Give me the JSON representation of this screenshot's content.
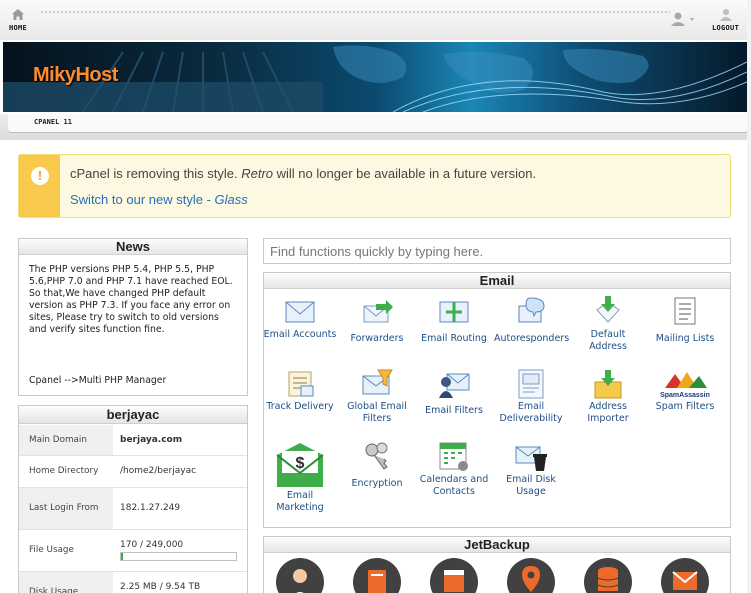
{
  "nav": {
    "home": "HOME",
    "logout": "LOGOUT"
  },
  "banner": {
    "logo": "MikyHost"
  },
  "tab": {
    "label": "CPANEL 11"
  },
  "notice": {
    "message_prefix": "cPanel is removing this style. ",
    "message_style": "Retro",
    "message_suffix": " will no longer be available in a future version.",
    "link_prefix": "Switch to our new style - ",
    "link_style": "Glass"
  },
  "news": {
    "title": "News",
    "body": "The PHP versions PHP 5.4, PHP 5.5, PHP 5.6,PHP 7.0 and PHP 7.1 have reached EOL. So that,We have changed PHP default version as PHP 7.3. If you face any error on sites, Please try to switch to old versions and verify sites function fine.",
    "footer": "Cpanel -->Multi PHP Manager"
  },
  "account": {
    "title": "berjayac",
    "rows": [
      {
        "label": "Main Domain",
        "value": "berjaya.com"
      },
      {
        "label": "Home Directory",
        "value": "/home2/berjayac"
      },
      {
        "label": "Last Login From",
        "value": "182.1.27.249"
      },
      {
        "label": "File Usage",
        "value": "170 / 249,000",
        "fraction": 0.0007
      },
      {
        "label": "Disk Usage",
        "value": "2.25 MB / 9.54 TB"
      }
    ]
  },
  "search": {
    "placeholder": "Find functions quickly by typing here."
  },
  "email": {
    "title": "Email",
    "items": [
      {
        "label": "Email Accounts",
        "icon": "email-accounts-icon"
      },
      {
        "label": "Forwarders",
        "icon": "forwarders-icon"
      },
      {
        "label": "Email Routing",
        "icon": "email-routing-icon"
      },
      {
        "label": "Autoresponders",
        "icon": "autoresponders-icon"
      },
      {
        "label": "Default Address",
        "icon": "default-address-icon"
      },
      {
        "label": "Mailing Lists",
        "icon": "mailing-lists-icon"
      },
      {
        "label": "Track Delivery",
        "icon": "track-delivery-icon"
      },
      {
        "label": "Global Email Filters",
        "icon": "global-email-filters-icon"
      },
      {
        "label": "Email Filters",
        "icon": "email-filters-icon"
      },
      {
        "label": "Email Deliverability",
        "icon": "email-deliverability-icon"
      },
      {
        "label": "Address Importer",
        "icon": "address-importer-icon"
      },
      {
        "label": "Spam Filters",
        "icon": "spam-filters-icon"
      },
      {
        "label": "Email Marketing",
        "icon": "email-marketing-icon"
      },
      {
        "label": "Encryption",
        "icon": "encryption-icon"
      },
      {
        "label": "Calendars and Contacts",
        "icon": "calendars-contacts-icon"
      },
      {
        "label": "Email Disk Usage",
        "icon": "email-disk-usage-icon"
      }
    ],
    "spam_logo_text": "SpamAssassin"
  },
  "jetbackup": {
    "title": "JetBackup"
  },
  "colors": {
    "accent_link": "#1f4f86",
    "notice_side": "#f8c94b",
    "logo": "#ff8b2b"
  }
}
